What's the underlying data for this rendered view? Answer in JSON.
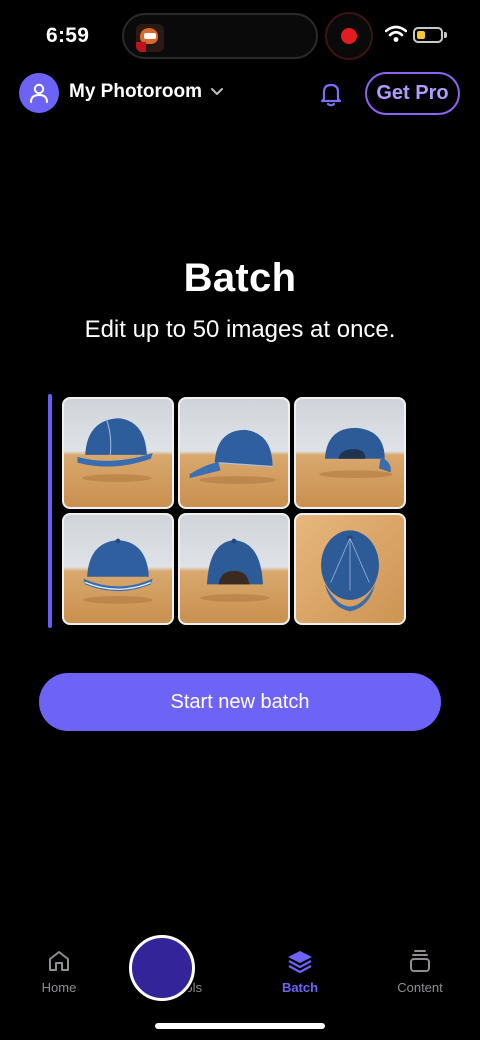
{
  "status_bar": {
    "time": "6:59",
    "battery_color": "#f4c92e",
    "record_color": "#e31b23"
  },
  "header": {
    "workspace_name": "My Photoroom",
    "get_pro_label": "Get Pro",
    "accent_color": "#6d64f7",
    "icons": [
      "user-icon",
      "chevron-down-icon",
      "bell-icon"
    ]
  },
  "main": {
    "title": "Batch",
    "subtitle": "Edit up to 50 images at once.",
    "start_button_label": "Start new batch",
    "images": [
      "cap-front-left",
      "cap-side",
      "cap-back",
      "cap-front",
      "cap-back-strap",
      "cap-top"
    ]
  },
  "nav": {
    "items": [
      {
        "label": "Home",
        "icon": "home-icon",
        "active": false
      },
      {
        "label": "AI Tools",
        "icon": "sparkles-icon",
        "active": false
      },
      {
        "label": "Batch",
        "icon": "layers-icon",
        "active": true
      },
      {
        "label": "Content",
        "icon": "stack-icon",
        "active": false
      }
    ]
  }
}
